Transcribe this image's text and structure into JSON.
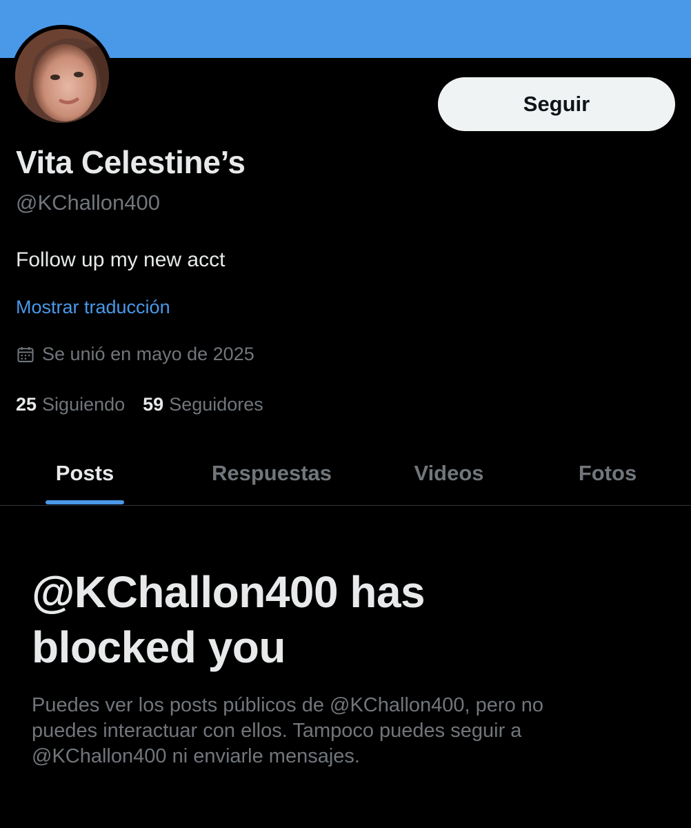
{
  "colors": {
    "banner": "#4a99e9",
    "accent": "#4a99e9",
    "background": "#000000",
    "primary_text": "#e7e9ea",
    "secondary_text": "#71767b",
    "button_bg": "#eff3f4"
  },
  "profile": {
    "display_name": "Vita Celestine’s",
    "handle": "@KChallon400",
    "bio": "Follow up my new acct",
    "translate_link": "Mostrar traducción",
    "joined_icon": "calendar-icon",
    "joined": "Se unió en mayo de 2025",
    "follow_button": "Seguir"
  },
  "stats": {
    "following_count": "25",
    "following_label": "Siguiendo",
    "followers_count": "59",
    "followers_label": "Seguidores"
  },
  "tabs": [
    {
      "label": "Posts",
      "active": true
    },
    {
      "label": "Respuestas",
      "active": false
    },
    {
      "label": "Videos",
      "active": false
    },
    {
      "label": "Fotos",
      "active": false
    }
  ],
  "blocked": {
    "title_line1": "@KChallon400 has",
    "title_line2": "blocked you",
    "line1": "Puedes ver los posts públicos de @KChallon400, pero no",
    "line2": "puedes interactuar con ellos. Tampoco puedes seguir a",
    "line3": "@KChallon400 ni enviarle mensajes."
  }
}
